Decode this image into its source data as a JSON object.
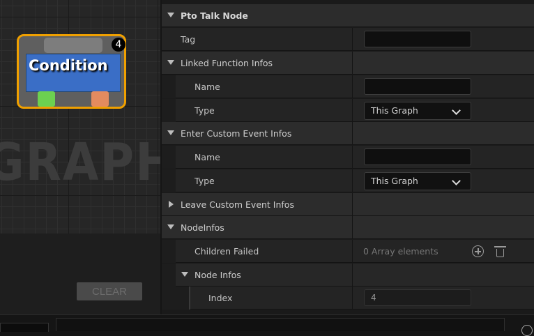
{
  "graph": {
    "watermark": "GRAPH",
    "node": {
      "title": "Condition",
      "badge": "4"
    },
    "clear_button": "CLEAR"
  },
  "details": {
    "rows": [
      {
        "label": "Pto Talk Node"
      },
      {
        "label": "Tag",
        "value": ""
      },
      {
        "label": "Linked Function Infos"
      },
      {
        "label": "Name",
        "value": ""
      },
      {
        "label": "Type",
        "value": "This Graph"
      },
      {
        "label": "Enter Custom Event Infos"
      },
      {
        "label": "Name",
        "value": ""
      },
      {
        "label": "Type",
        "value": "This Graph"
      },
      {
        "label": "Leave Custom Event Infos"
      },
      {
        "label": "NodeInfos"
      },
      {
        "label": "Children Failed",
        "value": "0 Array elements"
      },
      {
        "label": "Node Infos"
      },
      {
        "label": "Index",
        "value": "4"
      }
    ]
  },
  "icons": {
    "expanded": "triangle-down-icon",
    "collapsed": "triangle-right-icon",
    "add": "plus-circle-icon",
    "delete": "trash-icon",
    "dropdown": "chevron-down-icon"
  }
}
